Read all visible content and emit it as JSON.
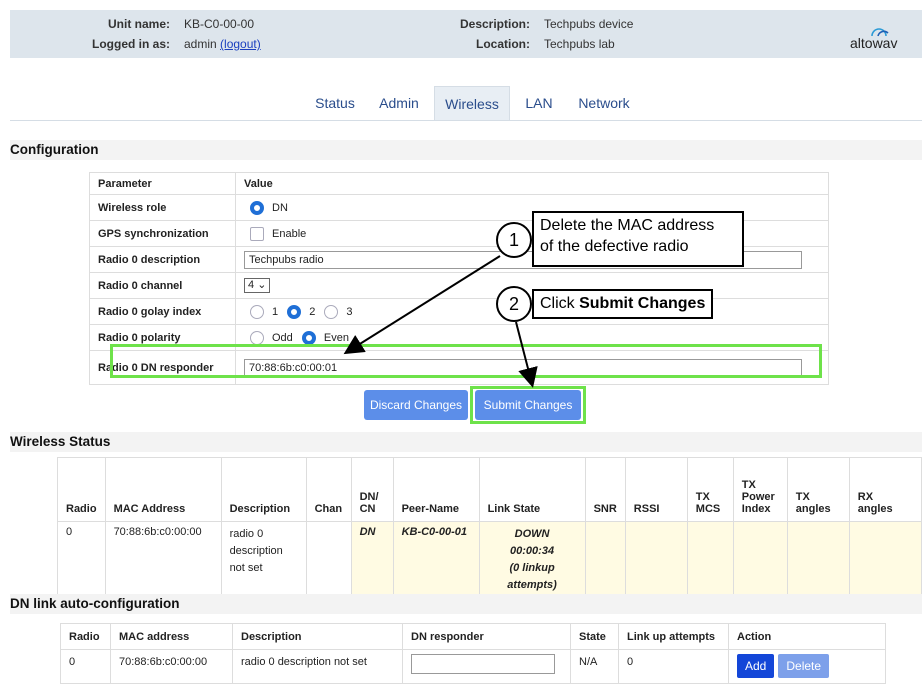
{
  "header": {
    "unit_name_label": "Unit name:",
    "unit_name": "KB-C0-00-00",
    "logged_in_label": "Logged in as:",
    "logged_in_user": "admin",
    "logout_link": "(logout)",
    "description_label": "Description:",
    "description": "Techpubs device",
    "location_label": "Location:",
    "location": "Techpubs lab",
    "logo_text": "altowav"
  },
  "tabs": [
    "Status",
    "Admin",
    "Wireless",
    "LAN",
    "Network"
  ],
  "active_tab": "Wireless",
  "configuration": {
    "title": "Configuration",
    "col_param": "Parameter",
    "col_value": "Value",
    "wireless_role_label": "Wireless role",
    "wireless_role_option": "DN",
    "gps_label": "GPS synchronization",
    "gps_option": "Enable",
    "radio_desc_label": "Radio 0 description",
    "radio_desc_value": "Techpubs radio",
    "radio_channel_label": "Radio 0 channel",
    "radio_channel_value": "4",
    "golay_label": "Radio 0 golay index",
    "golay_options": [
      "1",
      "2",
      "3"
    ],
    "golay_selected": "2",
    "polarity_label": "Radio 0 polarity",
    "polarity_options": [
      "Odd",
      "Even"
    ],
    "polarity_selected": "Even",
    "dn_responder_label": "Radio 0 DN responder",
    "dn_responder_value": "70:88:6b:c0:00:01",
    "discard_label": "Discard Changes",
    "submit_label": "Submit Changes"
  },
  "wireless_status": {
    "title": "Wireless Status",
    "headers": [
      "Radio",
      "MAC Address",
      "Description",
      "Chan",
      "DN/\nCN",
      "Peer-Name",
      "Link State",
      "SNR",
      "RSSI",
      "TX\nMCS",
      "TX\nPower\nIndex",
      "TX\nangles",
      "RX\nangles"
    ],
    "row": {
      "radio": "0",
      "mac": "70:88:6b:c0:00:00",
      "description": "radio 0\ndescription\nnot set",
      "chan": "",
      "dncn": "DN",
      "peer": "KB-C0-00-01",
      "link_state": "DOWN",
      "link_time": "00:00:34",
      "link_attempts": "(0 linkup attempts)"
    }
  },
  "dn_link": {
    "title": "DN link auto-configuration",
    "headers": [
      "Radio",
      "MAC address",
      "Description",
      "DN responder",
      "State",
      "Link up attempts",
      "Action"
    ],
    "row": {
      "radio": "0",
      "mac": "70:88:6b:c0:00:00",
      "description": "radio 0 description not set",
      "responder": "",
      "state": "N/A",
      "attempts": "0"
    },
    "add_label": "Add",
    "delete_label": "Delete"
  },
  "annotations": {
    "step1_number": "1",
    "step1_text_line1": "Delete the MAC address",
    "step1_text_line2": "of the defective radio",
    "step2_number": "2",
    "step2_text_pre": "Click ",
    "step2_text_bold": "Submit Changes"
  },
  "colors": {
    "accent": "#1f6fd6",
    "button": "#5c8ee9",
    "highlight": "#6ee24a",
    "status_fill": "#fffbe3"
  }
}
